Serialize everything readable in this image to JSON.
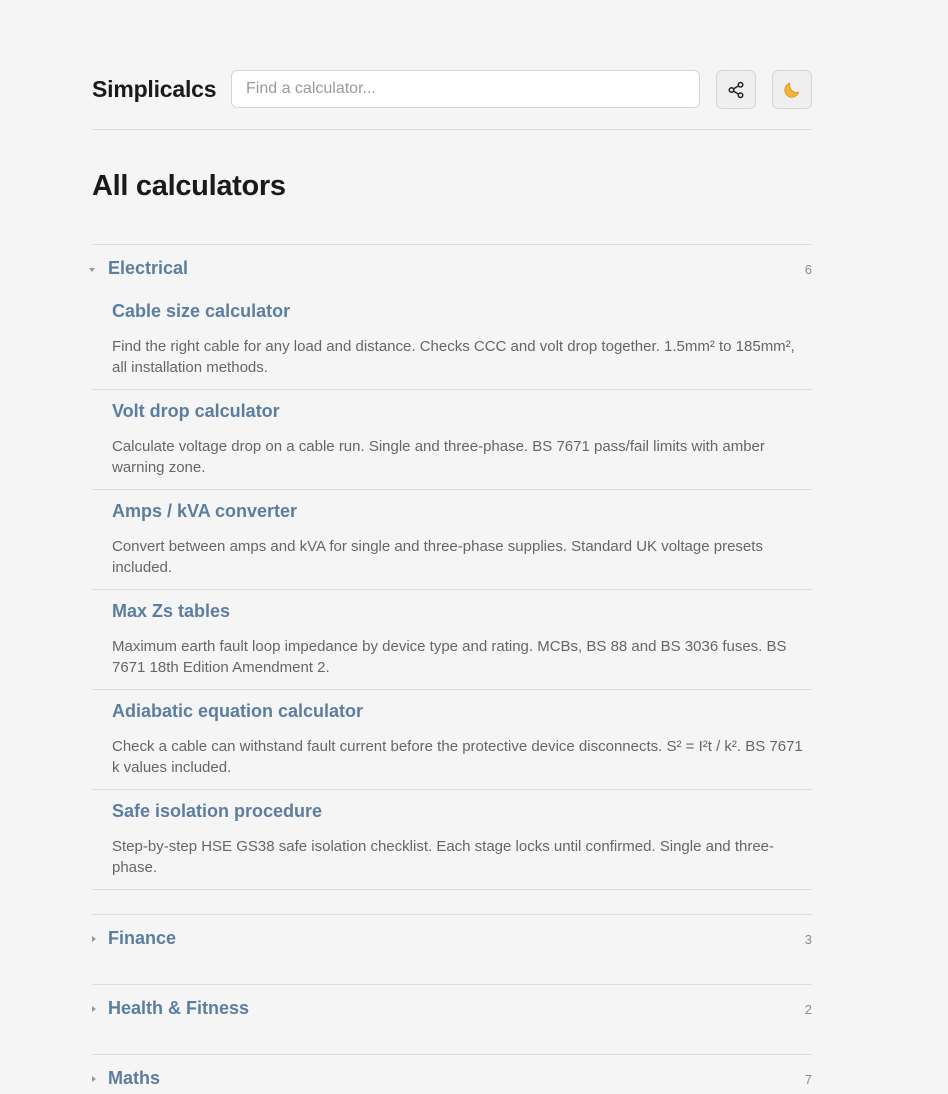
{
  "header": {
    "logo": "Simplicalcs",
    "search_placeholder": "Find a calculator...",
    "share_icon": "share-icon",
    "theme_icon": "moon-icon"
  },
  "page_title": "All calculators",
  "categories": [
    {
      "name": "Electrical",
      "count": "6",
      "expanded": true,
      "items": [
        {
          "title": "Cable size calculator",
          "description": "Find the right cable for any load and distance. Checks CCC and volt drop together. 1.5mm² to 185mm², all installation methods."
        },
        {
          "title": "Volt drop calculator",
          "description": "Calculate voltage drop on a cable run. Single and three-phase. BS 7671 pass/fail limits with amber warning zone."
        },
        {
          "title": "Amps / kVA converter",
          "description": "Convert between amps and kVA for single and three-phase supplies. Standard UK voltage presets included."
        },
        {
          "title": "Max Zs tables",
          "description": "Maximum earth fault loop impedance by device type and rating. MCBs, BS 88 and BS 3036 fuses. BS 7671 18th Edition Amendment 2."
        },
        {
          "title": "Adiabatic equation calculator",
          "description": "Check a cable can withstand fault current before the protective device disconnects. S² = I²t / k². BS 7671 k values included."
        },
        {
          "title": "Safe isolation procedure",
          "description": "Step-by-step HSE GS38 safe isolation checklist. Each stage locks until confirmed. Single and three-phase."
        }
      ]
    },
    {
      "name": "Finance",
      "count": "3",
      "expanded": false
    },
    {
      "name": "Health & Fitness",
      "count": "2",
      "expanded": false
    },
    {
      "name": "Maths",
      "count": "7",
      "expanded": false
    }
  ]
}
